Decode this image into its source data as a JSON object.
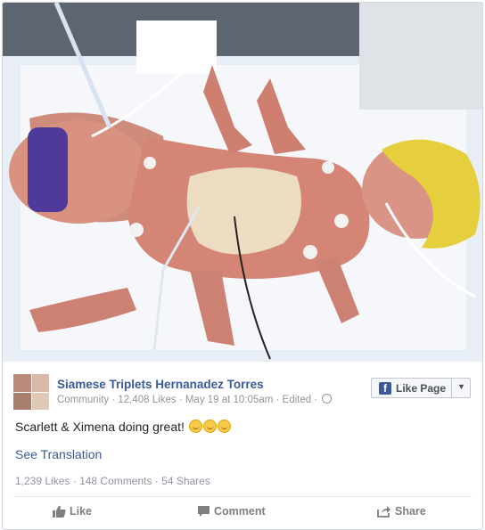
{
  "post": {
    "page_name": "Siamese Triplets Hernanadez Torres",
    "meta": {
      "category": "Community",
      "likes": "12,408 Likes",
      "time": "May 19 at 10:05am",
      "edited": "Edited"
    },
    "like_page_label": "Like Page",
    "message": "Scarlett & Ximena doing great!",
    "emoji_count": 3,
    "see_translation": "See Translation",
    "stats": {
      "likes": "1,239 Likes",
      "comments": "148 Comments",
      "shares": "54 Shares"
    },
    "actions": {
      "like": "Like",
      "comment": "Comment",
      "share": "Share"
    }
  },
  "colors": {
    "link": "#3b5998",
    "meta": "#90949c",
    "action": "#7f7f7f"
  },
  "icons": {
    "like": "thumbs-up-icon",
    "comment": "speech-bubble-icon",
    "share": "share-arrow-icon",
    "globe": "globe-icon",
    "facebook": "facebook-logo-icon",
    "dropdown": "caret-down-icon"
  }
}
